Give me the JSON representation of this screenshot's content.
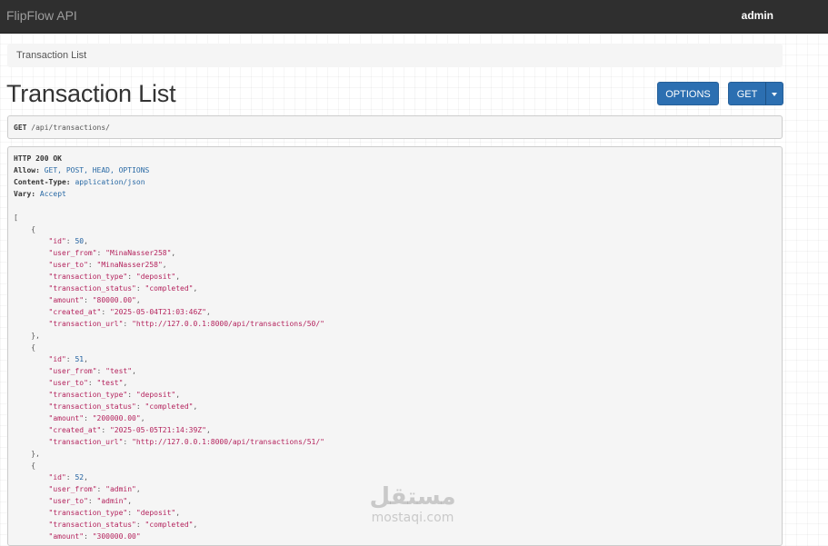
{
  "app": {
    "brand": "FlipFlow API",
    "user": "admin"
  },
  "breadcrumb": "Transaction List",
  "page": {
    "title": "Transaction List"
  },
  "actions": {
    "options_label": "OPTIONS",
    "get_label": "GET"
  },
  "request": {
    "method": "GET",
    "path": "/api/transactions/"
  },
  "response": {
    "status": "HTTP 200 OK",
    "headers": [
      {
        "name": "Allow:",
        "value": "GET, POST, HEAD, OPTIONS"
      },
      {
        "name": "Content-Type:",
        "value": "application/json"
      },
      {
        "name": "Vary:",
        "value": "Accept"
      }
    ],
    "transactions": [
      {
        "id": "50",
        "user_from": "\"MinaNasser258\"",
        "user_to": "\"MinaNasser258\"",
        "transaction_type": "\"deposit\"",
        "transaction_status": "\"completed\"",
        "amount": "\"80000.00\"",
        "created_at": "\"2025-05-04T21:03:46Z\"",
        "transaction_url": "\"http://127.0.0.1:8000/api/transactions/50/\""
      },
      {
        "id": "51",
        "user_from": "\"test\"",
        "user_to": "\"test\"",
        "transaction_type": "\"deposit\"",
        "transaction_status": "\"completed\"",
        "amount": "\"200000.00\"",
        "created_at": "\"2025-05-05T21:14:39Z\"",
        "transaction_url": "\"http://127.0.0.1:8000/api/transactions/51/\""
      },
      {
        "id": "52",
        "user_from": "\"admin\"",
        "user_to": "\"admin\"",
        "transaction_type": "\"deposit\"",
        "transaction_status": "\"completed\"",
        "amount": "\"300000.00\""
      }
    ]
  },
  "watermark": {
    "logo": "مستقل",
    "text": "mostaqi.com"
  }
}
